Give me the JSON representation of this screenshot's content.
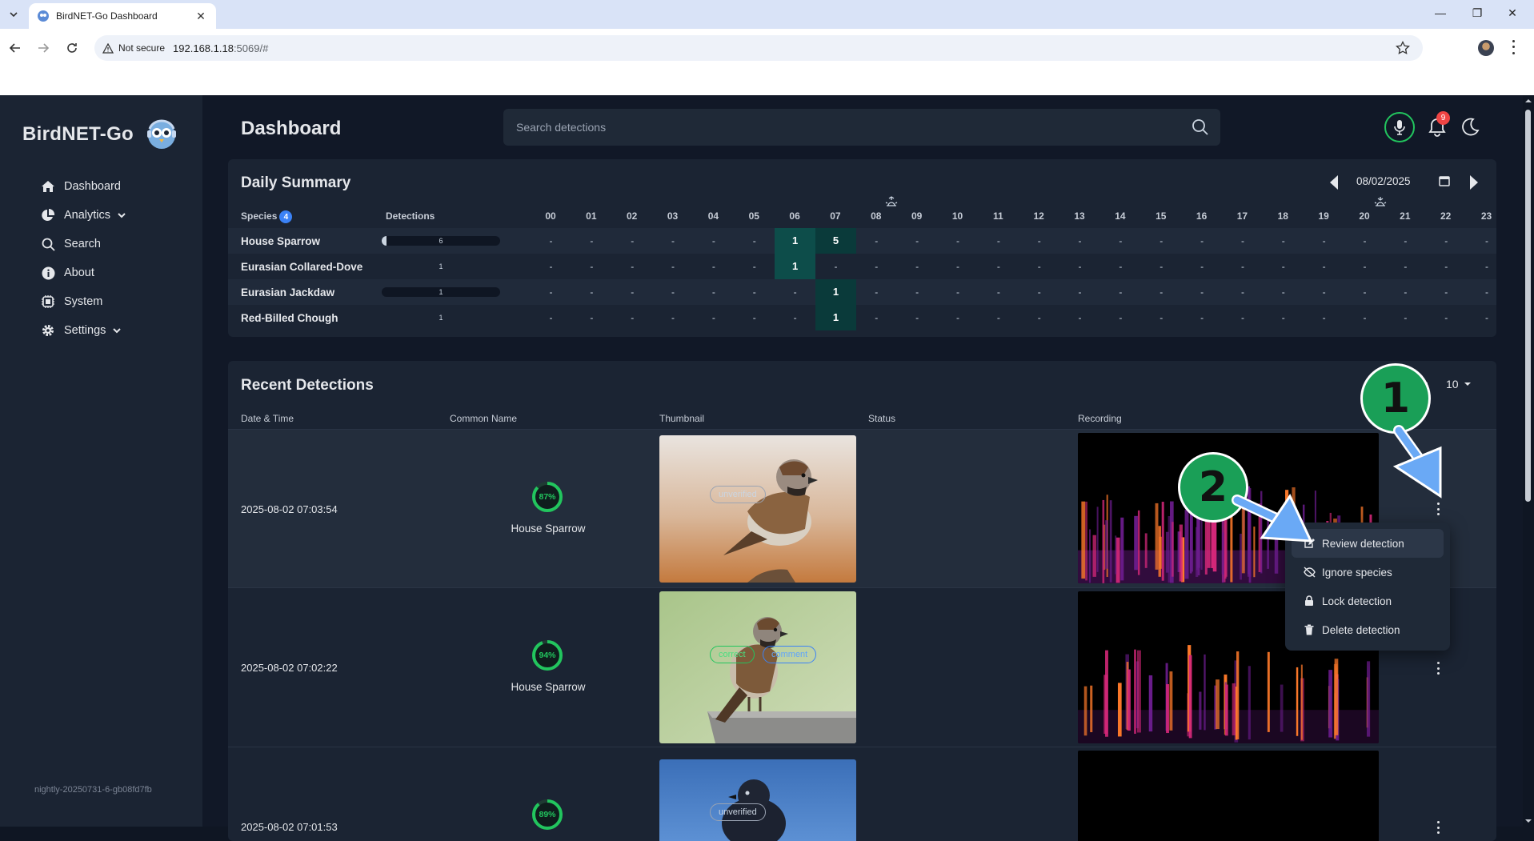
{
  "browser": {
    "tab_title": "BirdNET-Go Dashboard",
    "security_label": "Not secure",
    "url_host": "192.168.1.18",
    "url_rest": ":5069/#"
  },
  "app": {
    "brand": "BirdNET-Go",
    "version": "nightly-20250731-6-gb08fd7fb",
    "page_title": "Dashboard",
    "search_placeholder": "Search detections",
    "notification_count": "9",
    "nav": [
      {
        "label": "Dashboard",
        "icon": "home-icon"
      },
      {
        "label": "Analytics",
        "icon": "pie-chart-icon",
        "expandable": true
      },
      {
        "label": "Search",
        "icon": "search-icon"
      },
      {
        "label": "About",
        "icon": "info-icon"
      },
      {
        "label": "System",
        "icon": "cpu-icon"
      },
      {
        "label": "Settings",
        "icon": "gear-icon",
        "expandable": true
      }
    ]
  },
  "daily_summary": {
    "title": "Daily Summary",
    "date": "08/02/2025",
    "species_header": "Species",
    "species_count": "4",
    "detections_header": "Detections",
    "hours": [
      "00",
      "01",
      "02",
      "03",
      "04",
      "05",
      "06",
      "07",
      "08",
      "09",
      "10",
      "11",
      "12",
      "13",
      "14",
      "15",
      "16",
      "17",
      "18",
      "19",
      "20",
      "21",
      "22",
      "23"
    ],
    "rows": [
      {
        "name": "House Sparrow",
        "total": "6",
        "fill": 0.03,
        "hours": {
          "06": "1",
          "07": "5"
        }
      },
      {
        "name": "Eurasian Collared-Dove",
        "total": "1",
        "fill": 0.0,
        "hours": {
          "06": "1"
        }
      },
      {
        "name": "Eurasian Jackdaw",
        "total": "1",
        "fill": 0.0,
        "hours": {
          "07": "1"
        }
      },
      {
        "name": "Red-Billed Chough",
        "total": "1",
        "fill": 0.0,
        "hours": {
          "07": "1"
        }
      }
    ],
    "empty_cell": "-"
  },
  "recent": {
    "title": "Recent Detections",
    "show_label": "v:",
    "show_count": "10",
    "columns": [
      "Date & Time",
      "Common Name",
      "Thumbnail",
      "Status",
      "Recording"
    ],
    "rows": [
      {
        "time": "2025-08-02 07:03:54",
        "confidence": "87%",
        "confidence_value": 0.87,
        "name": "House Sparrow",
        "badges": [
          "unverified"
        ]
      },
      {
        "time": "2025-08-02 07:02:22",
        "confidence": "94%",
        "confidence_value": 0.94,
        "name": "House Sparrow",
        "badges": [
          "correct",
          "comment"
        ]
      },
      {
        "time": "2025-08-02 07:01:53",
        "confidence": "89%",
        "confidence_value": 0.89,
        "name": "",
        "badges": [
          "unverified"
        ]
      }
    ]
  },
  "menu": {
    "items": [
      {
        "label": "Review detection",
        "icon": "edit-icon"
      },
      {
        "label": "Ignore species",
        "icon": "eye-off-icon"
      },
      {
        "label": "Lock detection",
        "icon": "lock-icon"
      },
      {
        "label": "Delete detection",
        "icon": "trash-icon"
      }
    ]
  },
  "annotations": {
    "step1": "1",
    "step2": "2",
    "color": "#1a9f57",
    "arrow_color": "#6aa9f5"
  }
}
